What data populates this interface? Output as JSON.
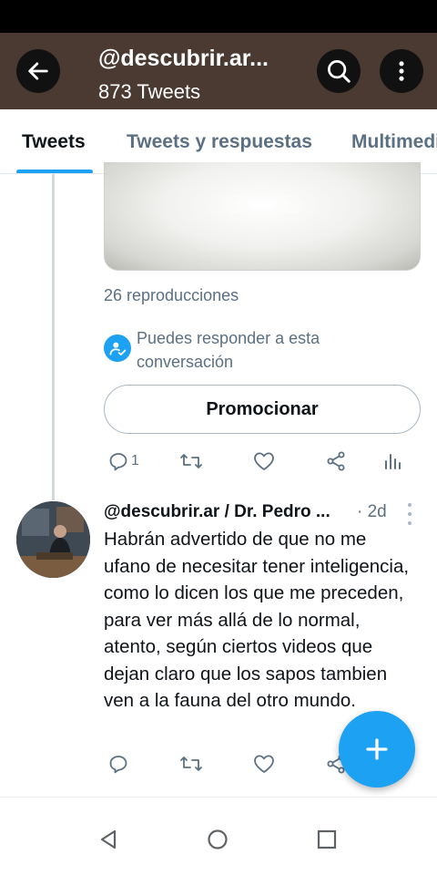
{
  "header": {
    "title": "@descubrir.ar...",
    "subtitle": "873 Tweets",
    "icons": {
      "back": "arrow-left-icon",
      "search": "search-icon",
      "more": "vertical-dots-icon"
    }
  },
  "tabs": [
    {
      "label": "Tweets",
      "active": true
    },
    {
      "label": "Tweets y respuestas",
      "active": false
    },
    {
      "label": "Multimedia",
      "active": false
    }
  ],
  "tweet1": {
    "views": "26 reproducciones",
    "reply_note": "Puedes responder a esta conversación",
    "promote_label": "Promocionar",
    "actions": {
      "reply_count": "1"
    }
  },
  "tweet2": {
    "author": "@descubrir.ar / Dr. Pedro ...",
    "time": "· 2d",
    "text": "Habrán advertido de que no me ufano de necesitar tener inteligencia, como lo dicen los que me preceden, para ver más allá de lo normal, atento, según ciertos videos que dejan claro que los sapos tambien ven a la fauna del otro mundo."
  },
  "fab": {
    "icon": "plus-icon"
  },
  "colors": {
    "accent": "#1da1f2",
    "header_bg": "#4a3a32",
    "secondary_text": "#5b7083"
  }
}
